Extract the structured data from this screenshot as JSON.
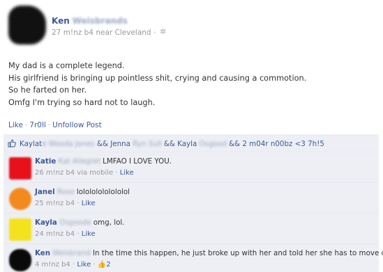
{
  "post": {
    "author_first": "Ken",
    "author_last_blurred": "Weisbrands",
    "meta": "27 m!nz b4 near Cleveland",
    "meta_dot": "·",
    "gear_icon": "gear-icon",
    "lines": [
      "My dad is a complete legend.",
      "His girlfriend is bringing up pointless shit, crying and causing a commotion.",
      "So he farted on her.",
      "Omfg I'm trying so hard not to laugh."
    ]
  },
  "actions": {
    "like": "Like",
    "count": "7r0ll",
    "unfollow": "Unfollow Post",
    "separator": "·"
  },
  "likes": {
    "icon": "thumbs-up-icon",
    "name1": "Kaylat",
    "name1_blur": "e Wooda Jones",
    "mid1": " && Jenna ",
    "name2_blur": "Ryn Sull",
    "mid2": " && Kayla ",
    "name3_blur": "Osgood",
    "tail": " && 2 m04r n00bz <3 7h!5"
  },
  "comments": [
    {
      "name": "Katie",
      "name_blur": " Kat Allegret",
      "text": " LMFAO I LOVE YOU.",
      "meta": "26 m!nz b4 via mobile",
      "like": "Like",
      "color": "#e8101a"
    },
    {
      "name": "Janel",
      "name_blur": " Rose",
      "text": " lolololololololol",
      "meta": "25 m!nz b4",
      "like": "Like",
      "color": "#f28a1e"
    },
    {
      "name": "Kayla",
      "name_blur": " Osgoode",
      "text": " omg, lol.",
      "meta": "24 m!nz b4",
      "like": "Like",
      "color": "#f4e21c"
    },
    {
      "name": "Ken",
      "name_blur": " Weisbrand",
      "text": " In the time this happen, he just broke up with her and told her she has to move out.",
      "meta": "4 m!nz b4",
      "like": "Like",
      "like_count": "2",
      "color": "#0a0a0a"
    }
  ]
}
